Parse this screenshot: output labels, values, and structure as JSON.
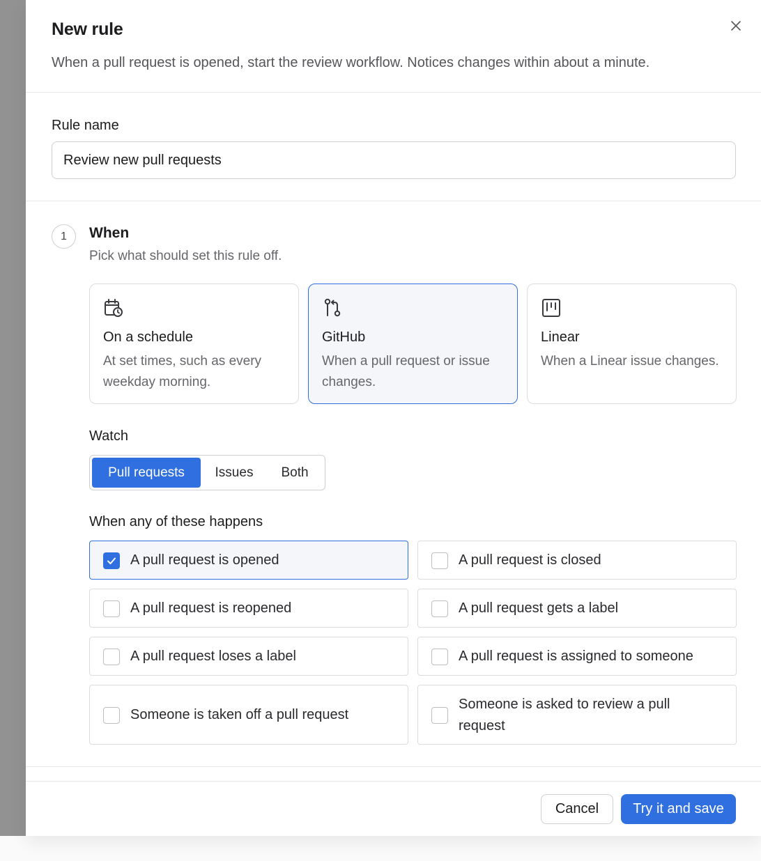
{
  "dialog": {
    "title": "New rule",
    "subtitle": "When a pull request is opened, start the review workflow. Notices changes within about a minute."
  },
  "rule_name": {
    "label": "Rule name",
    "value": "Review new pull requests"
  },
  "step": {
    "number": "1",
    "title": "When",
    "description": "Pick what should set this rule off."
  },
  "triggers": [
    {
      "title": "On a schedule",
      "description": "At set times, such as every weekday morning.",
      "icon": "calendar-clock-icon",
      "selected": false
    },
    {
      "title": "GitHub",
      "description": "When a pull request or issue changes.",
      "icon": "git-pull-request-icon",
      "selected": true
    },
    {
      "title": "Linear",
      "description": "When a Linear issue changes.",
      "icon": "kanban-board-icon",
      "selected": false
    }
  ],
  "watch": {
    "label": "Watch",
    "options": [
      "Pull requests",
      "Issues",
      "Both"
    ],
    "selected": "Pull requests"
  },
  "events": {
    "label": "When any of these happens",
    "items": [
      {
        "label": "A pull request is opened",
        "checked": true
      },
      {
        "label": "A pull request is closed",
        "checked": false
      },
      {
        "label": "A pull request is reopened",
        "checked": false
      },
      {
        "label": "A pull request gets a label",
        "checked": false
      },
      {
        "label": "A pull request loses a label",
        "checked": false
      },
      {
        "label": "A pull request is assigned to someone",
        "checked": false
      },
      {
        "label": "Someone is taken off a pull request",
        "checked": false
      },
      {
        "label": "Someone is asked to review a pull request",
        "checked": false
      }
    ]
  },
  "footer": {
    "cancel_label": "Cancel",
    "save_label": "Try it and save"
  },
  "colors": {
    "accent": "#2f6fe0",
    "selected_bg": "#f5f6f9",
    "border": "#dcdce0"
  }
}
